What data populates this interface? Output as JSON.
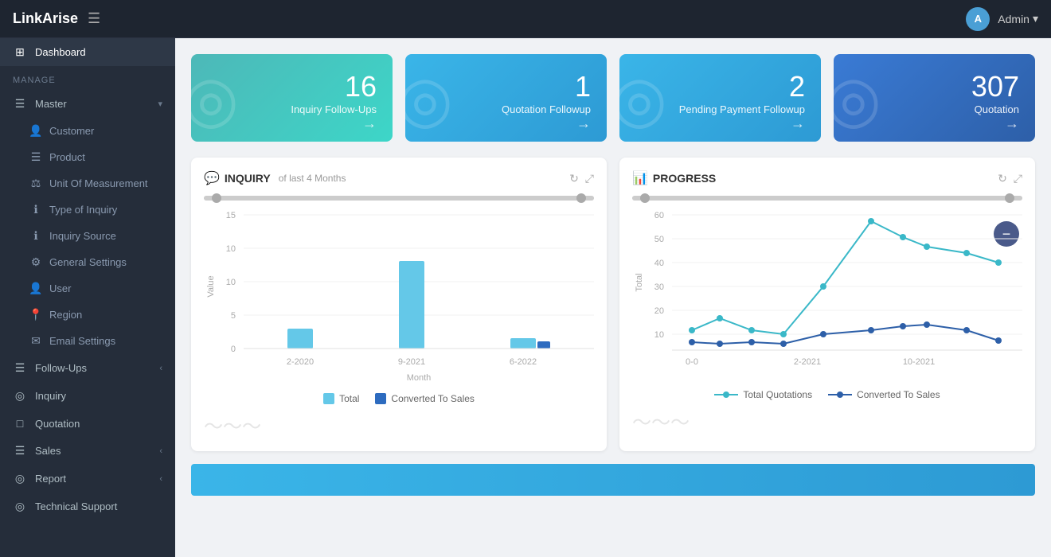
{
  "app": {
    "name": "LinkArise",
    "user": "Admin"
  },
  "topbar": {
    "logo": "LinkArise",
    "hamburger": "☰",
    "avatar_initial": "A",
    "admin_label": "Admin",
    "chevron": "▾"
  },
  "sidebar": {
    "section_manage": "MANAGE",
    "items": [
      {
        "id": "dashboard",
        "label": "Dashboard",
        "icon": "⊞",
        "has_sub": false
      },
      {
        "id": "master",
        "label": "Master",
        "icon": "☰",
        "has_sub": true,
        "expanded": true
      },
      {
        "id": "customer",
        "label": "Customer",
        "icon": "👤",
        "is_sub": true
      },
      {
        "id": "product",
        "label": "Product",
        "icon": "☰",
        "is_sub": true
      },
      {
        "id": "unit-of-measurement",
        "label": "Unit Of Measurement",
        "icon": "⚖",
        "is_sub": true
      },
      {
        "id": "type-of-inquiry",
        "label": "Type of Inquiry",
        "icon": "ℹ",
        "is_sub": true
      },
      {
        "id": "inquiry-source",
        "label": "Inquiry Source",
        "icon": "ℹ",
        "is_sub": true
      },
      {
        "id": "general-settings",
        "label": "General Settings",
        "icon": "⚙",
        "is_sub": true
      },
      {
        "id": "user",
        "label": "User",
        "icon": "👤",
        "is_sub": true
      },
      {
        "id": "region",
        "label": "Region",
        "icon": "📍",
        "is_sub": true
      },
      {
        "id": "email-settings",
        "label": "Email Settings",
        "icon": "✉",
        "is_sub": true
      },
      {
        "id": "follow-ups",
        "label": "Follow-Ups",
        "icon": "☰",
        "has_sub": true
      },
      {
        "id": "inquiry",
        "label": "Inquiry",
        "icon": "◎"
      },
      {
        "id": "quotation",
        "label": "Quotation",
        "icon": "□"
      },
      {
        "id": "sales",
        "label": "Sales",
        "icon": "☰",
        "has_sub": true
      },
      {
        "id": "report",
        "label": "Report",
        "icon": "◎",
        "has_sub": true
      },
      {
        "id": "technical-support",
        "label": "Technical Support",
        "icon": "◎"
      }
    ]
  },
  "stat_cards": [
    {
      "id": "inquiry-followups",
      "number": "16",
      "label": "Inquiry Follow-Ups",
      "gradient": "teal"
    },
    {
      "id": "quotation-followup",
      "number": "1",
      "label": "Quotation Followup",
      "gradient": "blue"
    },
    {
      "id": "pending-payment",
      "number": "2",
      "label": "Pending Payment Followup",
      "gradient": "blue"
    },
    {
      "id": "quotation",
      "number": "307",
      "label": "Quotation",
      "gradient": "darkblue"
    }
  ],
  "inquiry_chart": {
    "title": "INQUIRY",
    "subtitle": "of last 4 Months",
    "y_axis_label": "Value",
    "x_axis_label": "Month",
    "y_ticks": [
      "0",
      "5",
      "10",
      "15"
    ],
    "bars": [
      {
        "month": "2-2020",
        "total": 3,
        "converted": 0
      },
      {
        "month": "9-2021",
        "total": 13,
        "converted": 0
      },
      {
        "month": "6-2022",
        "total": 1.5,
        "converted": 1
      }
    ],
    "legend": [
      {
        "label": "Total",
        "color": "#64c8e8"
      },
      {
        "label": "Converted To Sales",
        "color": "#2d6bbf"
      }
    ]
  },
  "progress_chart": {
    "title": "PROGRESS",
    "y_axis_label": "Total",
    "y_ticks": [
      "0",
      "10",
      "20",
      "30",
      "40",
      "50",
      "60"
    ],
    "x_ticks": [
      "0-0",
      "2-2021",
      "10-2021"
    ],
    "legend": [
      {
        "label": "Total Quotations",
        "color": "#3ab5c8"
      },
      {
        "label": "Converted To Sales",
        "color": "#2d5fa8"
      }
    ]
  }
}
